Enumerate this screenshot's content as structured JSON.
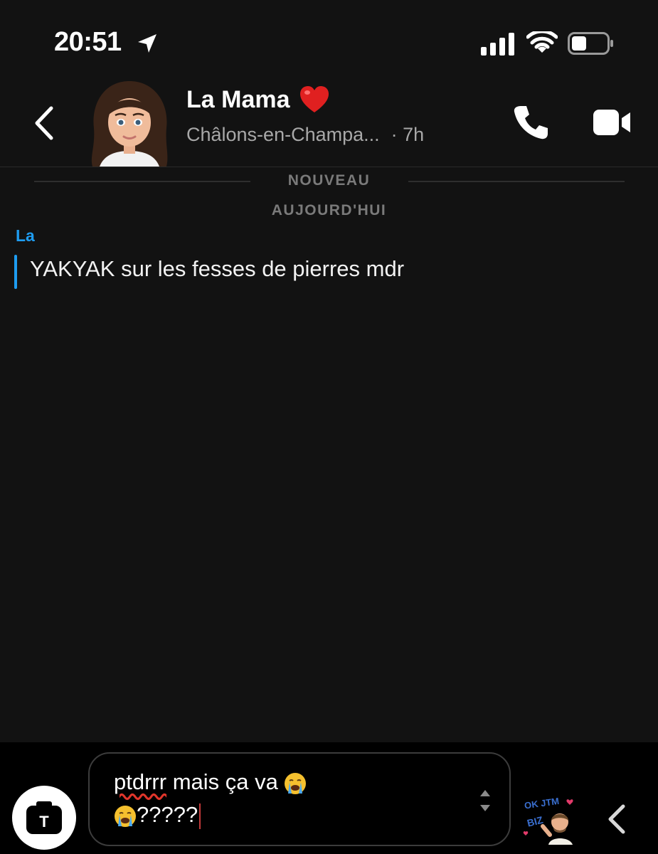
{
  "status": {
    "time": "20:51"
  },
  "header": {
    "name": "La Mama",
    "location": "Châlons-en-Champa...",
    "time_ago": "· 7h"
  },
  "chat": {
    "new_label": "NOUVEAU",
    "date_label": "AUJOURD'HUI",
    "messages": [
      {
        "sender": "La",
        "text": "YAKYAK sur les fesses de pierres mdr"
      }
    ]
  },
  "composer": {
    "word1": "ptdrrr",
    "line1_rest": " mais ça va ",
    "line2_text": "?????",
    "camera_letter": "T",
    "sticker_text_1": "OK JTM",
    "sticker_text_2": "BIZ"
  },
  "colors": {
    "accent": "#1e9cf0",
    "background": "#121212",
    "heart": "#e02020"
  },
  "icons": [
    "location-arrow-icon",
    "signal-icon",
    "wifi-icon",
    "battery-icon",
    "back-chevron-icon",
    "heart-icon",
    "phone-icon",
    "video-icon",
    "camera-icon",
    "crying-face-emoji",
    "stepper-icon",
    "expand-chevron-icon"
  ]
}
